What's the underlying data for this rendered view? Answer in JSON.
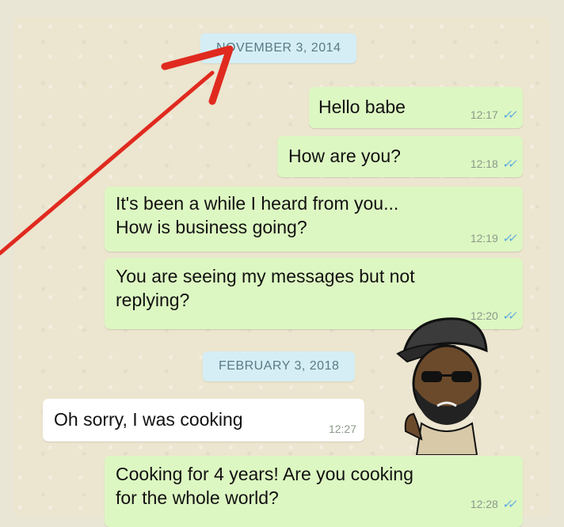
{
  "dates": {
    "first": "NOVEMBER 3, 2014",
    "second": "FEBRUARY 3, 2018"
  },
  "messages": [
    {
      "text": "Hello babe",
      "time": "12:17",
      "ticks": "✓✓"
    },
    {
      "text": "How are you?",
      "time": "12:18",
      "ticks": "✓✓"
    },
    {
      "text": "It's been a while I heard from you...\nHow is business going?",
      "time": "12:19",
      "ticks": "✓✓"
    },
    {
      "text": "You are seeing my messages but not\nreplying?",
      "time": "12:20",
      "ticks": "✓✓"
    },
    {
      "text": "Oh sorry, I was cooking",
      "time": "12:27"
    },
    {
      "text": "Cooking for 4 years! Are you cooking\nfor the whole world?",
      "time": "12:28",
      "ticks": "✓✓"
    }
  ],
  "colors": {
    "outgoing_bubble": "#ddf7c2",
    "incoming_bubble": "#ffffff",
    "date_chip": "#d5eef5",
    "read_ticks": "#5aa9e0",
    "arrow": "#e02a1f"
  },
  "icons": [
    "read-receipt-icon",
    "arrow-annotation",
    "cap-sunglasses-sticker"
  ]
}
